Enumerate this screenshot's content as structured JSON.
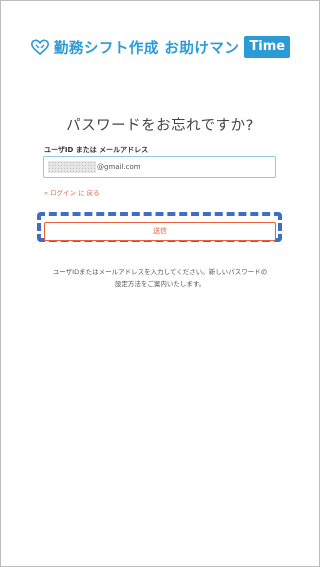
{
  "header": {
    "logo_icon": "heart-hands-icon",
    "logo_text": "勤務シフト作成 お助けマン",
    "logo_badge": "Time",
    "brand_color": "#2b9bd6"
  },
  "form": {
    "title": "パスワードをお忘れですか?",
    "user_label": "ユーザID または メールアドレス",
    "user_value_suffix": "@gmail.com",
    "back_link": "« ログイン に 戻る",
    "submit_label": "送信",
    "accent_color": "#e8603c"
  },
  "info": {
    "line1": "ユーザIDまたはメールアドレスを入力してください。新しいパスワードの",
    "line2": "設定方法をご案内いたします。"
  }
}
